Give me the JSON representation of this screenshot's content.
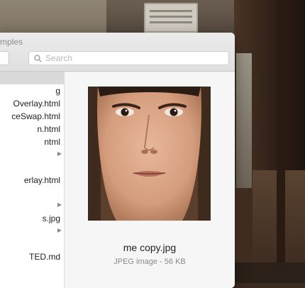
{
  "window": {
    "title": "mples"
  },
  "search": {
    "placeholder": "Search",
    "icon": "search-icon"
  },
  "sidebar": {
    "items": [
      {
        "label": "",
        "selected": true,
        "has_arrow": false
      },
      {
        "label": "g",
        "has_arrow": false
      },
      {
        "label": "Overlay.html",
        "has_arrow": false
      },
      {
        "label": "ceSwap.html",
        "has_arrow": false
      },
      {
        "label": "n.html",
        "has_arrow": false
      },
      {
        "label": "ntml",
        "has_arrow": false
      },
      {
        "label": "",
        "has_arrow": true
      },
      {
        "label": "",
        "has_arrow": false
      },
      {
        "label": "erlay.html",
        "has_arrow": false
      },
      {
        "label": "",
        "has_arrow": false
      },
      {
        "label": "",
        "has_arrow": true
      },
      {
        "label": "s.jpg",
        "has_arrow": false
      },
      {
        "label": "",
        "has_arrow": true
      },
      {
        "label": "",
        "has_arrow": false
      },
      {
        "label": "TED.md",
        "has_arrow": false
      }
    ]
  },
  "preview": {
    "filename": "me copy.jpg",
    "meta": "JPEG image - 56 KB"
  },
  "colors": {
    "selection": "#dadada",
    "window_bg": "#f6f6f6"
  }
}
